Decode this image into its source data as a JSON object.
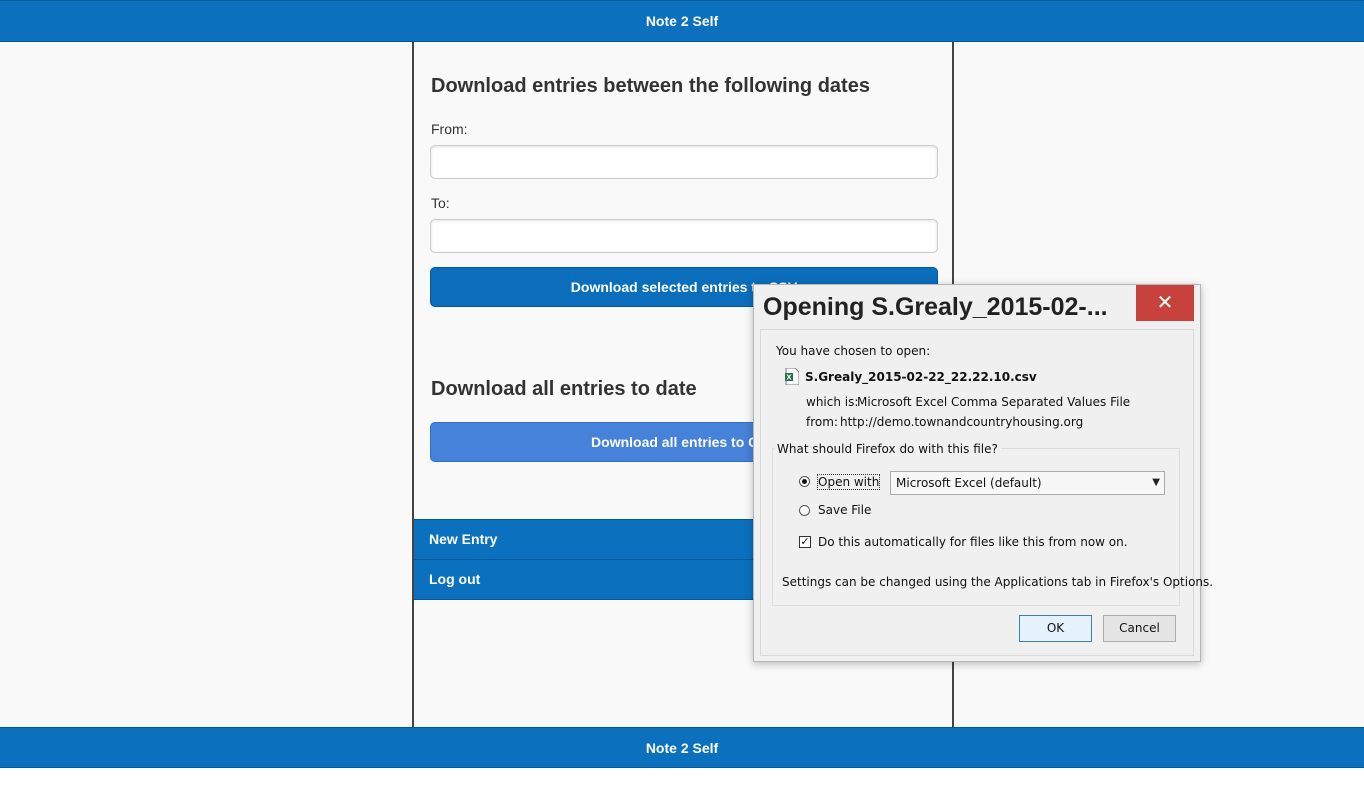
{
  "app": {
    "title": "Note 2 Self",
    "footer": "Note 2 Self"
  },
  "date_section": {
    "heading": "Download entries between the following dates",
    "from_label": "From:",
    "from_value": "",
    "to_label": "To:",
    "to_value": "",
    "button_label": "Download selected entries to CSV"
  },
  "all_section": {
    "heading": "Download all entries to date",
    "button_label": "Download all entries to CSV"
  },
  "nav": {
    "items": [
      {
        "label": "New Entry"
      },
      {
        "label": "Log out"
      }
    ]
  },
  "dialog": {
    "title": "Opening S.Grealy_2015-02-...",
    "intro": "You have chosen to open:",
    "filename": "S.Grealy_2015-02-22_22.22.10.csv",
    "which_is_label": "which is:",
    "which_is_value": "Microsoft Excel Comma Separated Values File",
    "from_label": "from:",
    "from_value": "http://demo.townandcountryhousing.org",
    "question": "What should Firefox do with this file?",
    "open_with_label": "Open with",
    "open_with_app": "Microsoft Excel (default)",
    "save_file_label": "Save File",
    "auto_label": "Do this automatically for files like this from now on.",
    "settings_note": "Settings can be changed using the Applications tab in Firefox's Options.",
    "ok_label": "OK",
    "cancel_label": "Cancel",
    "selected_option": "open_with",
    "auto_checked": true
  },
  "colors": {
    "brand_blue": "#0b70bd",
    "active_blue": "#4682d9",
    "close_red": "#c7413d"
  },
  "icons": {
    "close": "close-icon",
    "file": "excel-file-icon",
    "dropdown": "chevron-down-icon"
  }
}
